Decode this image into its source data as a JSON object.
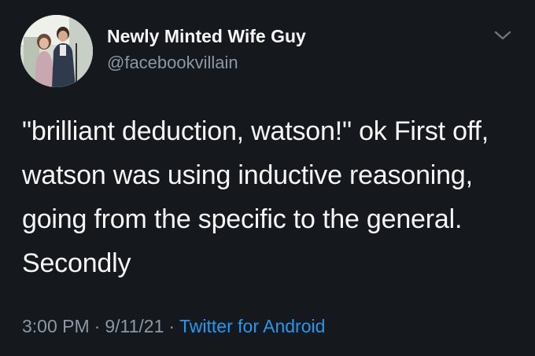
{
  "user": {
    "display_name": "Newly Minted Wife Guy",
    "handle": "@facebookvillain",
    "avatar_icon": "profile-photo-avatar"
  },
  "tweet": {
    "text": "\"brilliant deduction, watson!\" ok First off, watson was using inductive reasoning, going from the specific to the general. Secondly"
  },
  "meta": {
    "time": "3:00 PM",
    "separator": "·",
    "date": "9/11/21",
    "source": "Twitter for Android"
  },
  "colors": {
    "background": "#15181d",
    "text": "#f4f6f8",
    "secondary_text": "#8b98a5",
    "link": "#1d9bf0"
  },
  "icons": {
    "menu": "chevron-down-icon"
  }
}
